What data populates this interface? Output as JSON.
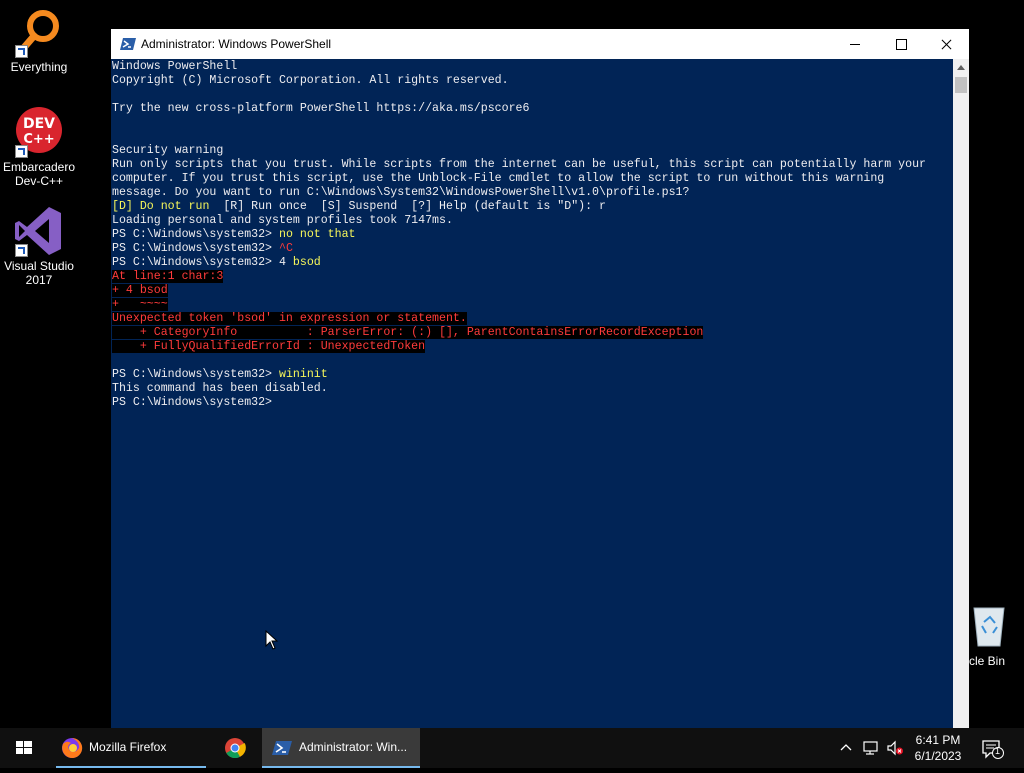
{
  "desktop": {
    "icons": [
      {
        "label": "Everything"
      },
      {
        "label": "Embarcadero Dev-C++"
      },
      {
        "label": "Visual Studio 2017"
      },
      {
        "label": "cle Bin"
      }
    ]
  },
  "window": {
    "title": "Administrator: Windows PowerShell",
    "console_bg": "#012456"
  },
  "console": {
    "lines": [
      [
        {
          "t": "Windows PowerShell",
          "c": "white"
        }
      ],
      [
        {
          "t": "Copyright (C) Microsoft Corporation. All rights reserved.",
          "c": "white"
        }
      ],
      [],
      [
        {
          "t": "Try the new cross-platform PowerShell https://aka.ms/pscore6",
          "c": "white"
        }
      ],
      [],
      [],
      [
        {
          "t": "Security warning",
          "c": "white"
        }
      ],
      [
        {
          "t": "Run only scripts that you trust. While scripts from the internet can be useful, this script can potentially harm your",
          "c": "white"
        }
      ],
      [
        {
          "t": "computer. If you trust this script, use the Unblock-File cmdlet to allow the script to run without this warning",
          "c": "white"
        }
      ],
      [
        {
          "t": "message. Do you want to run C:\\Windows\\System32\\WindowsPowerShell\\v1.0\\profile.ps1?",
          "c": "white"
        }
      ],
      [
        {
          "t": "[D] Do not run  ",
          "c": "yellow"
        },
        {
          "t": "[R] Run once  [S] Suspend  [?] Help (default is \"D\"): r",
          "c": "white"
        }
      ],
      [
        {
          "t": "Loading personal and system profiles took 7147ms.",
          "c": "white"
        }
      ],
      [
        {
          "t": "PS C:\\Windows\\system32> ",
          "c": "white"
        },
        {
          "t": "no not that",
          "c": "yellow"
        }
      ],
      [
        {
          "t": "PS C:\\Windows\\system32> ",
          "c": "white"
        },
        {
          "t": "^C",
          "c": "err-fg"
        }
      ],
      [
        {
          "t": "PS C:\\Windows\\system32> ",
          "c": "white"
        },
        {
          "t": "4 ",
          "c": "white"
        },
        {
          "t": "bsod",
          "c": "yellow"
        }
      ],
      [
        {
          "t": "At line:1 char:3",
          "c": "err"
        }
      ],
      [
        {
          "t": "+ 4 bsod",
          "c": "err"
        }
      ],
      [
        {
          "t": "+   ~~~~",
          "c": "err"
        }
      ],
      [
        {
          "t": "Unexpected token 'bsod' in expression or statement.",
          "c": "err"
        }
      ],
      [
        {
          "t": "    + CategoryInfo          : ParserError: (:) [], ParentContainsErrorRecordException",
          "c": "err"
        }
      ],
      [
        {
          "t": "    + FullyQualifiedErrorId : UnexpectedToken",
          "c": "err"
        }
      ],
      [],
      [
        {
          "t": "PS C:\\Windows\\system32> ",
          "c": "white"
        },
        {
          "t": "wininit",
          "c": "yellow"
        }
      ],
      [
        {
          "t": "This command has been disabled.",
          "c": "white"
        }
      ],
      [
        {
          "t": "PS C:\\Windows\\system32>",
          "c": "white"
        }
      ]
    ]
  },
  "taskbar": {
    "firefox_label": "Mozilla Firefox",
    "powershell_label": "Administrator: Win...",
    "clock_time": "6:41 PM",
    "clock_date": "6/1/2023",
    "notification_count": "1",
    "accent": "#76b9ed"
  }
}
